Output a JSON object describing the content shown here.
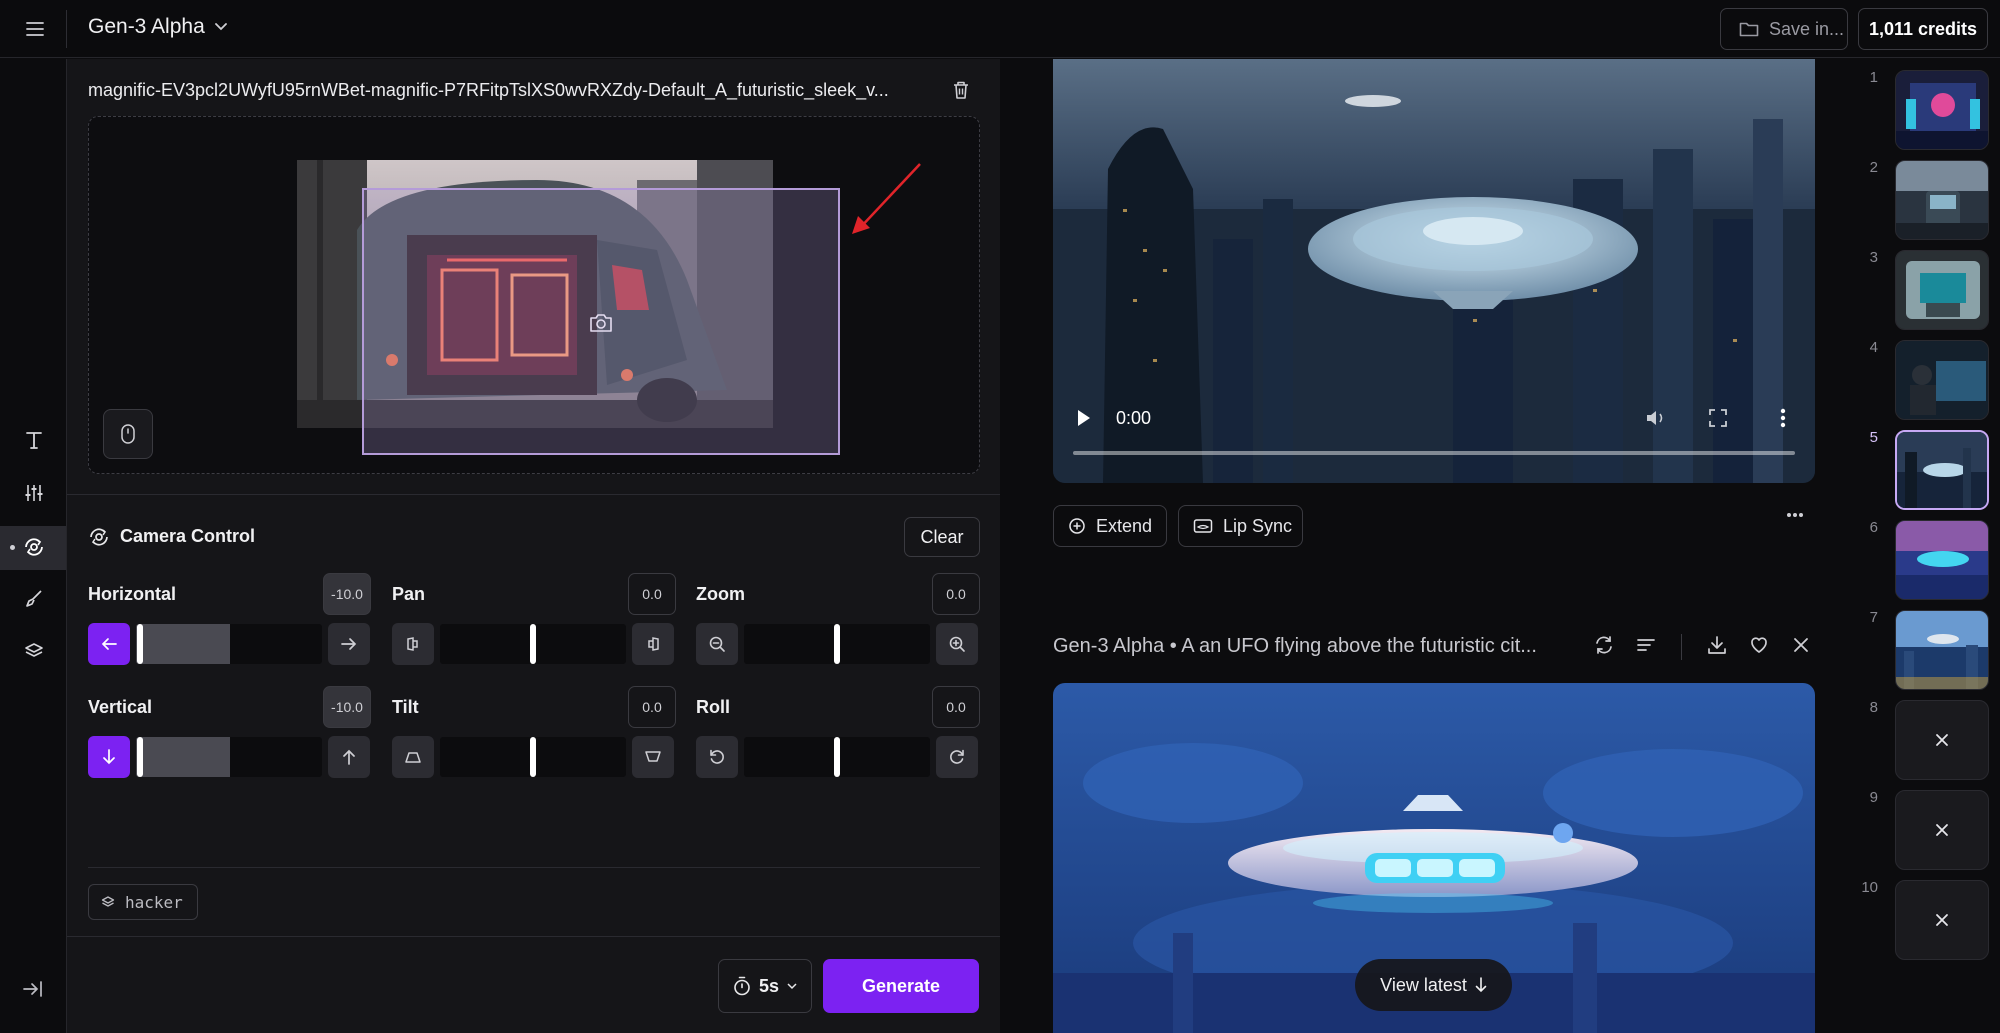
{
  "header": {
    "model_title": "Gen-3 Alpha",
    "save_label": "Save in...",
    "credits_label": "1,011 credits"
  },
  "rail": {
    "items": [
      "text-tool",
      "adjustments",
      "camera-control",
      "brush",
      "layers"
    ],
    "active": "camera-control"
  },
  "input": {
    "filename": "magnific-EV3pcl2UWyfU95rnWBet-magnific-P7RFitpTslXS0wvRXZdy-Default_A_futuristic_sleek_v..."
  },
  "camera_control": {
    "title": "Camera Control",
    "clear_label": "Clear",
    "controls": [
      {
        "label": "Horizontal",
        "value": "-10.0",
        "level": -1.0
      },
      {
        "label": "Pan",
        "value": "0.0",
        "level": 0.0
      },
      {
        "label": "Zoom",
        "value": "0.0",
        "level": 0.0
      },
      {
        "label": "Vertical",
        "value": "-10.0",
        "level": -1.0
      },
      {
        "label": "Tilt",
        "value": "0.0",
        "level": 0.0
      },
      {
        "label": "Roll",
        "value": "0.0",
        "level": 0.0
      }
    ]
  },
  "tag": {
    "label": "hacker"
  },
  "footer": {
    "duration_label": "5s",
    "generate_label": "Generate"
  },
  "output1": {
    "time": "0:00",
    "extend_label": "Extend",
    "lipsync_label": "Lip Sync"
  },
  "output2": {
    "title": "Gen-3 Alpha • A an UFO flying above the futuristic cit...",
    "view_latest_label": "View latest"
  },
  "thumbnails": [
    {
      "num": "1",
      "state": "image"
    },
    {
      "num": "2",
      "state": "image"
    },
    {
      "num": "3",
      "state": "image"
    },
    {
      "num": "4",
      "state": "image"
    },
    {
      "num": "5",
      "state": "active"
    },
    {
      "num": "6",
      "state": "image"
    },
    {
      "num": "7",
      "state": "image"
    },
    {
      "num": "8",
      "state": "failed"
    },
    {
      "num": "9",
      "state": "failed"
    },
    {
      "num": "10",
      "state": "failed"
    }
  ],
  "colors": {
    "accent": "#7c22f2",
    "selection": "#c7a9f4",
    "panel_bg": "#151518",
    "page_bg": "#0c0c0e"
  }
}
